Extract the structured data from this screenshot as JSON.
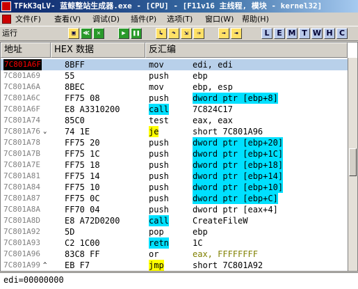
{
  "title": "TFkK3qLV- 蓝鲸整站生成器.exe - [CPU] - [F11v16 主线程, 模块 - kernel32]",
  "menu": [
    "文件(F)",
    "查看(V)",
    "调试(D)",
    "插件(P)",
    "选项(T)",
    "窗口(W)",
    "帮助(H)"
  ],
  "status": "运行",
  "toolbar_letters": [
    "L",
    "E",
    "M",
    "T",
    "W",
    "H",
    "C"
  ],
  "headers": {
    "address": "地址",
    "hex": "HEX 数据",
    "disasm": "反汇编"
  },
  "rows": [
    {
      "addr": "7C801A6F",
      "hex": "8BFF",
      "mn": "mov",
      "ops": "edi, edi",
      "style": "",
      "sel": true,
      "eip": true,
      "mark": ""
    },
    {
      "addr": "7C801A69",
      "hex": "55",
      "mn": "push",
      "ops": "ebp",
      "style": "",
      "mark": ""
    },
    {
      "addr": "7C801A6A",
      "hex": "8BEC",
      "mn": "mov",
      "ops": "ebp, esp",
      "style": "",
      "mark": ""
    },
    {
      "addr": "7C801A6C",
      "hex": "FF75 08",
      "mn": "push",
      "ops": "dword ptr [ebp+8]",
      "style": "hl",
      "mark": ""
    },
    {
      "addr": "7C801A6F",
      "hex": "E8 A3310200",
      "mn": "call",
      "ops": "7C824C17",
      "style": "call",
      "mark": ""
    },
    {
      "addr": "7C801A74",
      "hex": "85C0",
      "mn": "test",
      "ops": "eax, eax",
      "style": "",
      "mark": ""
    },
    {
      "addr": "7C801A76",
      "hex": "74 1E",
      "mn": "je",
      "ops": "short 7C801A96",
      "style": "jmp",
      "mark": "⌄"
    },
    {
      "addr": "7C801A78",
      "hex": "FF75 20",
      "mn": "push",
      "ops": "dword ptr [ebp+20]",
      "style": "hl",
      "mark": ""
    },
    {
      "addr": "7C801A7B",
      "hex": "FF75 1C",
      "mn": "push",
      "ops": "dword ptr [ebp+1C]",
      "style": "hl",
      "mark": ""
    },
    {
      "addr": "7C801A7E",
      "hex": "FF75 18",
      "mn": "push",
      "ops": "dword ptr [ebp+18]",
      "style": "hl",
      "mark": ""
    },
    {
      "addr": "7C801A81",
      "hex": "FF75 14",
      "mn": "push",
      "ops": "dword ptr [ebp+14]",
      "style": "hl",
      "mark": ""
    },
    {
      "addr": "7C801A84",
      "hex": "FF75 10",
      "mn": "push",
      "ops": "dword ptr [ebp+10]",
      "style": "hl",
      "mark": ""
    },
    {
      "addr": "7C801A87",
      "hex": "FF75 0C",
      "mn": "push",
      "ops": "dword ptr [ebp+C]",
      "style": "hl",
      "mark": ""
    },
    {
      "addr": "7C801A8A",
      "hex": "FF70 04",
      "mn": "push",
      "ops": "dword ptr [eax+4]",
      "style": "",
      "mark": ""
    },
    {
      "addr": "7C801A8D",
      "hex": "E8 A72D0200",
      "mn": "call",
      "ops": "CreateFileW",
      "style": "call",
      "mark": ""
    },
    {
      "addr": "7C801A92",
      "hex": "5D",
      "mn": "pop",
      "ops": "ebp",
      "style": "",
      "mark": ""
    },
    {
      "addr": "7C801A93",
      "hex": "C2 1C00",
      "mn": "retn",
      "ops": "1C",
      "style": "retn",
      "mark": ""
    },
    {
      "addr": "7C801A96",
      "hex": "83C8 FF",
      "mn": "or",
      "ops": "eax, FFFFFFFF",
      "style": "num",
      "mark": ""
    },
    {
      "addr": "7C801A99",
      "hex": "EB F7",
      "mn": "jmp",
      "ops": "short 7C801A92",
      "style": "jmp",
      "mark": "^"
    }
  ],
  "info": "edi=00000000"
}
